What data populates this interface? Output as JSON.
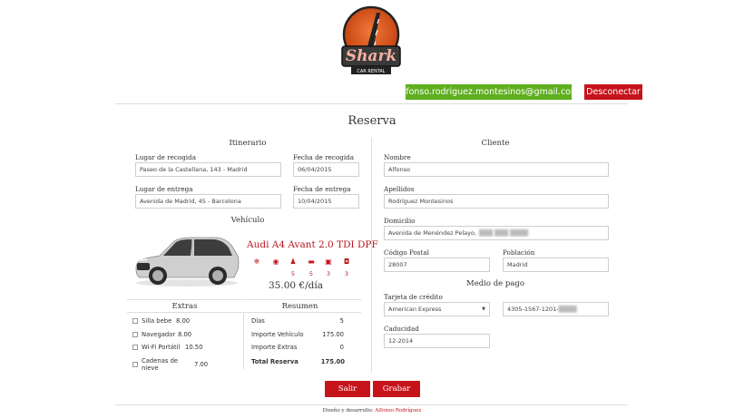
{
  "header": {
    "logo_text": "Shark",
    "logo_sub": "CAR RENTAL",
    "email": "alfonso.rodriguez.montesinos@gmail.com",
    "logout": "Desconectar"
  },
  "title": "Reserva",
  "itinerary": {
    "heading": "Itinerario",
    "pickup_label": "Lugar de recogida",
    "pickup_value": "Paseo de la Castellana, 143 - Madrid",
    "pickup_date_label": "Fecha de recogida",
    "pickup_date_value": "06/04/2015",
    "dropoff_label": "Lugar de entrega",
    "dropoff_value": "Avenida de Madrid, 45 - Barcelona",
    "dropoff_date_label": "Fecha de entrega",
    "dropoff_date_value": "10/04/2015"
  },
  "vehicle": {
    "heading": "Vehículo",
    "name": "Audi A4 Avant 2.0 TDI DPF",
    "features": [
      {
        "icon": "snowflake-icon",
        "value": ""
      },
      {
        "icon": "gps-icon",
        "value": ""
      },
      {
        "icon": "seat-icon",
        "value": "5"
      },
      {
        "icon": "door-icon",
        "value": "5"
      },
      {
        "icon": "suitcase-icon",
        "value": "3"
      },
      {
        "icon": "bag-icon",
        "value": "3"
      }
    ],
    "price": "35.00 €/día"
  },
  "extras": {
    "heading": "Extras",
    "items": [
      {
        "label": "Silla bebe",
        "price": "8.00"
      },
      {
        "label": "Navegador",
        "price": "8.00"
      },
      {
        "label": "Wi-Fi Portátil",
        "price": "10.50"
      },
      {
        "label": "Cadenas de nieve",
        "price": "7.00"
      }
    ]
  },
  "summary": {
    "heading": "Resumen",
    "rows": [
      {
        "label": "Días",
        "value": "5"
      },
      {
        "label": "Importe Vehículo",
        "value": "175.00"
      },
      {
        "label": "Importe Extras",
        "value": "0"
      },
      {
        "label": "Total Reserva",
        "value": "175.00"
      }
    ]
  },
  "client": {
    "heading": "Cliente",
    "name_label": "Nombre",
    "name_value": "Alfonso",
    "surname_label": "Apellidos",
    "surname_value": "Rodríguez Montesinos",
    "address_label": "Domicilio",
    "address_value": "Avenida de Menéndez Pelayo,",
    "postal_label": "Código Postal",
    "postal_value": "28007",
    "city_label": "Población",
    "city_value": "Madrid"
  },
  "payment": {
    "heading": "Medio de pago",
    "card_label": "Tarjeta de crédito",
    "card_type": "American Express",
    "card_number": "4305-1567-1201-",
    "expiry_label": "Caducidad",
    "expiry_value": "12-2014"
  },
  "actions": {
    "exit": "Salir",
    "save": "Grabar"
  },
  "footer": {
    "text": "Diseño y desarrollo:",
    "author": "Alfonso Rodríguez"
  }
}
